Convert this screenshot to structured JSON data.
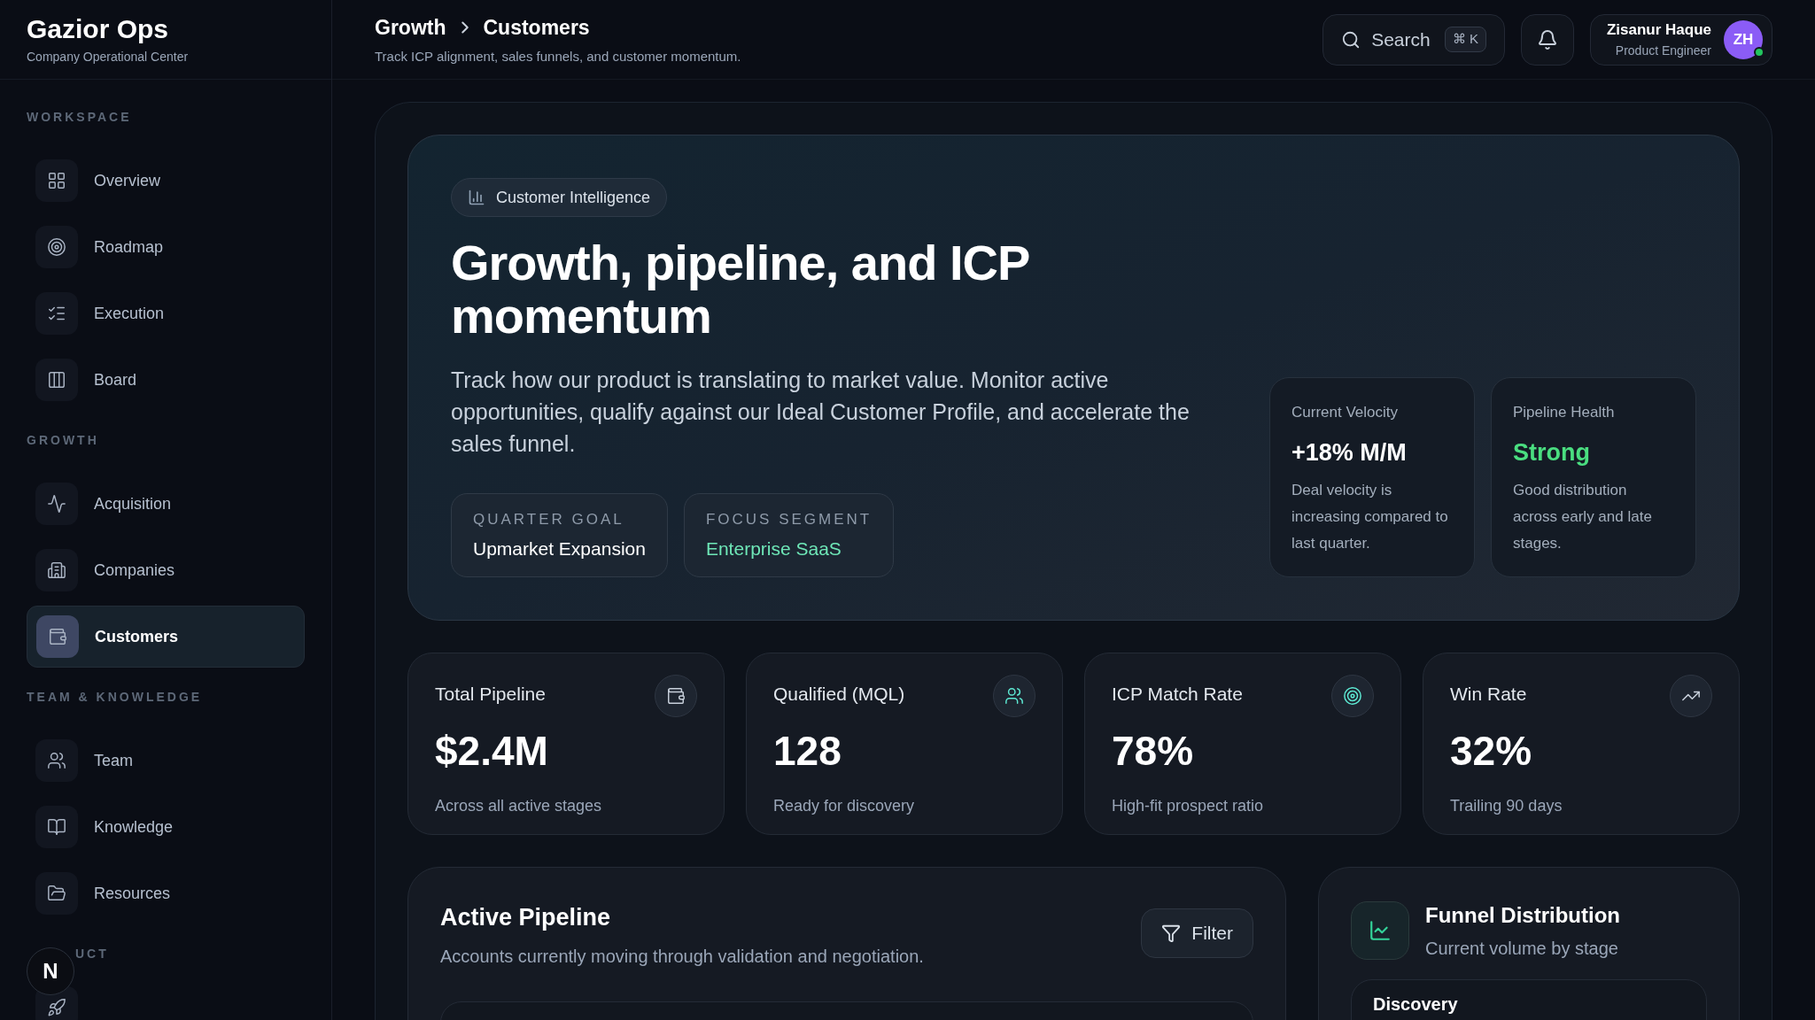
{
  "brand": {
    "title": "Gazior Ops",
    "subtitle": "Company Operational Center"
  },
  "sidebar": {
    "sections": [
      {
        "heading": "WORKSPACE",
        "items": [
          {
            "label": "Overview",
            "selected": false
          },
          {
            "label": "Roadmap",
            "selected": false
          },
          {
            "label": "Execution",
            "selected": false
          },
          {
            "label": "Board",
            "selected": false
          }
        ]
      },
      {
        "heading": "GROWTH",
        "items": [
          {
            "label": "Acquisition",
            "selected": false
          },
          {
            "label": "Companies",
            "selected": false
          },
          {
            "label": "Customers",
            "selected": true
          }
        ]
      },
      {
        "heading": "TEAM & KNOWLEDGE",
        "items": [
          {
            "label": "Team",
            "selected": false
          },
          {
            "label": "Knowledge",
            "selected": false
          },
          {
            "label": "Resources",
            "selected": false
          }
        ]
      },
      {
        "heading": "UCT"
      }
    ]
  },
  "floating_badge": "N",
  "header": {
    "breadcrumb": [
      "Growth",
      "Customers"
    ],
    "subtitle": "Track ICP alignment, sales funnels, and customer momentum.",
    "search": {
      "label": "Search",
      "shortcut": "⌘ K"
    },
    "user": {
      "name": "Zisanur Haque",
      "role": "Product Engineer",
      "initials": "ZH",
      "online": true
    }
  },
  "hero": {
    "badge": "Customer Intelligence",
    "title": "Growth, pipeline, and ICP momentum",
    "description": "Track how our product is translating to market value. Monitor active opportunities, qualify against our Ideal Customer Profile, and accelerate the sales funnel.",
    "tags": [
      {
        "label": "QUARTER GOAL",
        "value": "Upmarket Expansion",
        "accent": false
      },
      {
        "label": "FOCUS SEGMENT",
        "value": "Enterprise SaaS",
        "accent": true
      }
    ],
    "insights": [
      {
        "label": "Current Velocity",
        "value": "+18% M/M",
        "accent": false,
        "note": "Deal velocity is increasing compared to last quarter."
      },
      {
        "label": "Pipeline Health",
        "value": "Strong",
        "accent": true,
        "note": "Good distribution across early and late stages."
      }
    ]
  },
  "stats": [
    {
      "label": "Total Pipeline",
      "value": "$2.4M",
      "note": "Across all active stages",
      "accent": false
    },
    {
      "label": "Qualified (MQL)",
      "value": "128",
      "note": "Ready for discovery",
      "accent": true
    },
    {
      "label": "ICP Match Rate",
      "value": "78%",
      "note": "High-fit prospect ratio",
      "accent": true
    },
    {
      "label": "Win Rate",
      "value": "32%",
      "note": "Trailing 90 days",
      "accent": false
    }
  ],
  "pipeline": {
    "title": "Active Pipeline",
    "subtitle": "Accounts currently moving through validation and negotiation.",
    "filter": "Filter"
  },
  "funnel": {
    "title": "Funnel Distribution",
    "subtitle": "Current volume by stage",
    "stages": [
      "Discovery"
    ]
  }
}
